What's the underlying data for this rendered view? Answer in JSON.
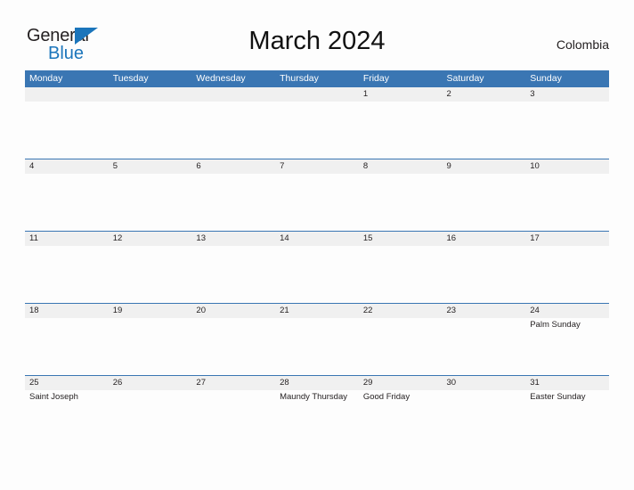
{
  "brand": {
    "name_top": "General",
    "name_bottom": "Blue",
    "flag_icon": "blue-triangle-flag",
    "color_dark": "#231f20",
    "color_blue": "#1b75bb"
  },
  "header": {
    "title": "March 2024",
    "country": "Colombia"
  },
  "theme": {
    "header_blue": "#3a76b3",
    "band_gray": "#f0f0f0",
    "page_bg": "#fdfdfd",
    "text": "#231f20"
  },
  "calendar": {
    "day_headers": [
      "Monday",
      "Tuesday",
      "Wednesday",
      "Thursday",
      "Friday",
      "Saturday",
      "Sunday"
    ],
    "weeks": [
      {
        "days": [
          {
            "date": "",
            "event": ""
          },
          {
            "date": "",
            "event": ""
          },
          {
            "date": "",
            "event": ""
          },
          {
            "date": "",
            "event": ""
          },
          {
            "date": "1",
            "event": ""
          },
          {
            "date": "2",
            "event": ""
          },
          {
            "date": "3",
            "event": ""
          }
        ]
      },
      {
        "days": [
          {
            "date": "4",
            "event": ""
          },
          {
            "date": "5",
            "event": ""
          },
          {
            "date": "6",
            "event": ""
          },
          {
            "date": "7",
            "event": ""
          },
          {
            "date": "8",
            "event": ""
          },
          {
            "date": "9",
            "event": ""
          },
          {
            "date": "10",
            "event": ""
          }
        ]
      },
      {
        "days": [
          {
            "date": "11",
            "event": ""
          },
          {
            "date": "12",
            "event": ""
          },
          {
            "date": "13",
            "event": ""
          },
          {
            "date": "14",
            "event": ""
          },
          {
            "date": "15",
            "event": ""
          },
          {
            "date": "16",
            "event": ""
          },
          {
            "date": "17",
            "event": ""
          }
        ]
      },
      {
        "days": [
          {
            "date": "18",
            "event": ""
          },
          {
            "date": "19",
            "event": ""
          },
          {
            "date": "20",
            "event": ""
          },
          {
            "date": "21",
            "event": ""
          },
          {
            "date": "22",
            "event": ""
          },
          {
            "date": "23",
            "event": ""
          },
          {
            "date": "24",
            "event": "Palm Sunday"
          }
        ]
      },
      {
        "days": [
          {
            "date": "25",
            "event": "Saint Joseph"
          },
          {
            "date": "26",
            "event": ""
          },
          {
            "date": "27",
            "event": ""
          },
          {
            "date": "28",
            "event": "Maundy Thursday"
          },
          {
            "date": "29",
            "event": "Good Friday"
          },
          {
            "date": "30",
            "event": ""
          },
          {
            "date": "31",
            "event": "Easter Sunday"
          }
        ]
      }
    ]
  }
}
